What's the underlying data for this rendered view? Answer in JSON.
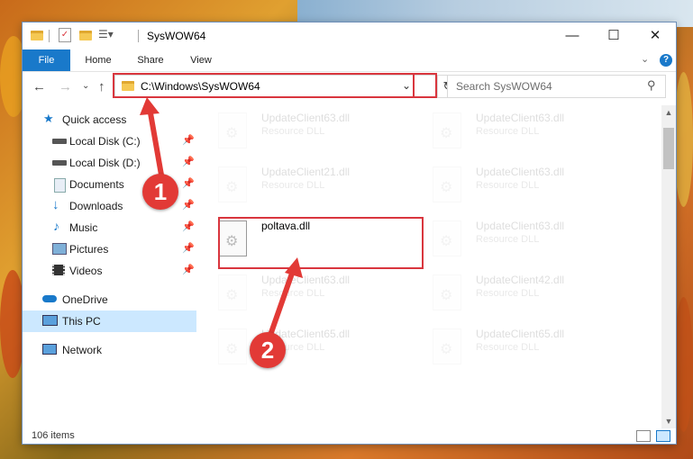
{
  "window": {
    "title": "SysWOW64",
    "controls": {
      "minimize": "—",
      "maximize": "☐",
      "close": "✕"
    }
  },
  "ribbon": {
    "tabs": [
      "File",
      "Home",
      "Share",
      "View"
    ],
    "help": "?"
  },
  "address": {
    "path": "C:\\Windows\\SysWOW64",
    "search_placeholder": "Search SysWOW64"
  },
  "sidebar": {
    "items": [
      {
        "label": "Quick access",
        "icon": "star-icon",
        "pinned": false
      },
      {
        "label": "Local Disk (C:)",
        "icon": "drive-icon",
        "pinned": true
      },
      {
        "label": "Local Disk (D:)",
        "icon": "drive-icon",
        "pinned": true
      },
      {
        "label": "Documents",
        "icon": "documents-icon",
        "pinned": true
      },
      {
        "label": "Downloads",
        "icon": "download-icon",
        "pinned": true
      },
      {
        "label": "Music",
        "icon": "music-icon",
        "pinned": true
      },
      {
        "label": "Pictures",
        "icon": "pictures-icon",
        "pinned": true
      },
      {
        "label": "Videos",
        "icon": "videos-icon",
        "pinned": true
      },
      {
        "label": "OneDrive",
        "icon": "cloud-icon",
        "pinned": false
      },
      {
        "label": "This PC",
        "icon": "computer-icon",
        "pinned": false,
        "selected": true
      },
      {
        "label": "Network",
        "icon": "network-icon",
        "pinned": false
      }
    ]
  },
  "files": {
    "left_column": [
      {
        "name": "UpdateClient63.dll",
        "type": "Resource DLL",
        "faded": true
      },
      {
        "name": "UpdateClient21.dll",
        "type": "Resource DLL",
        "faded": true
      },
      {
        "name": "poltava.dll",
        "type": "",
        "faded": false
      },
      {
        "name": "UpdateClient63.dll",
        "type": "Resource DLL",
        "faded": true
      },
      {
        "name": "UpdateClient65.dll",
        "type": "Resource DLL",
        "faded": true
      }
    ],
    "right_column": [
      {
        "name": "UpdateClient63.dll",
        "type": "Resource DLL",
        "faded": true
      },
      {
        "name": "UpdateClient63.dll",
        "type": "Resource DLL",
        "faded": true
      },
      {
        "name": "UpdateClient63.dll",
        "type": "Resource DLL",
        "faded": true
      },
      {
        "name": "UpdateClient42.dll",
        "type": "Resource DLL",
        "faded": true
      },
      {
        "name": "UpdateClient65.dll",
        "type": "Resource DLL",
        "faded": true
      }
    ]
  },
  "status": {
    "item_count": "106 items"
  },
  "callouts": {
    "one": "1",
    "two": "2"
  },
  "colors": {
    "accent": "#1979ca",
    "callout": "#e23a36",
    "selected": "#cce8ff"
  }
}
